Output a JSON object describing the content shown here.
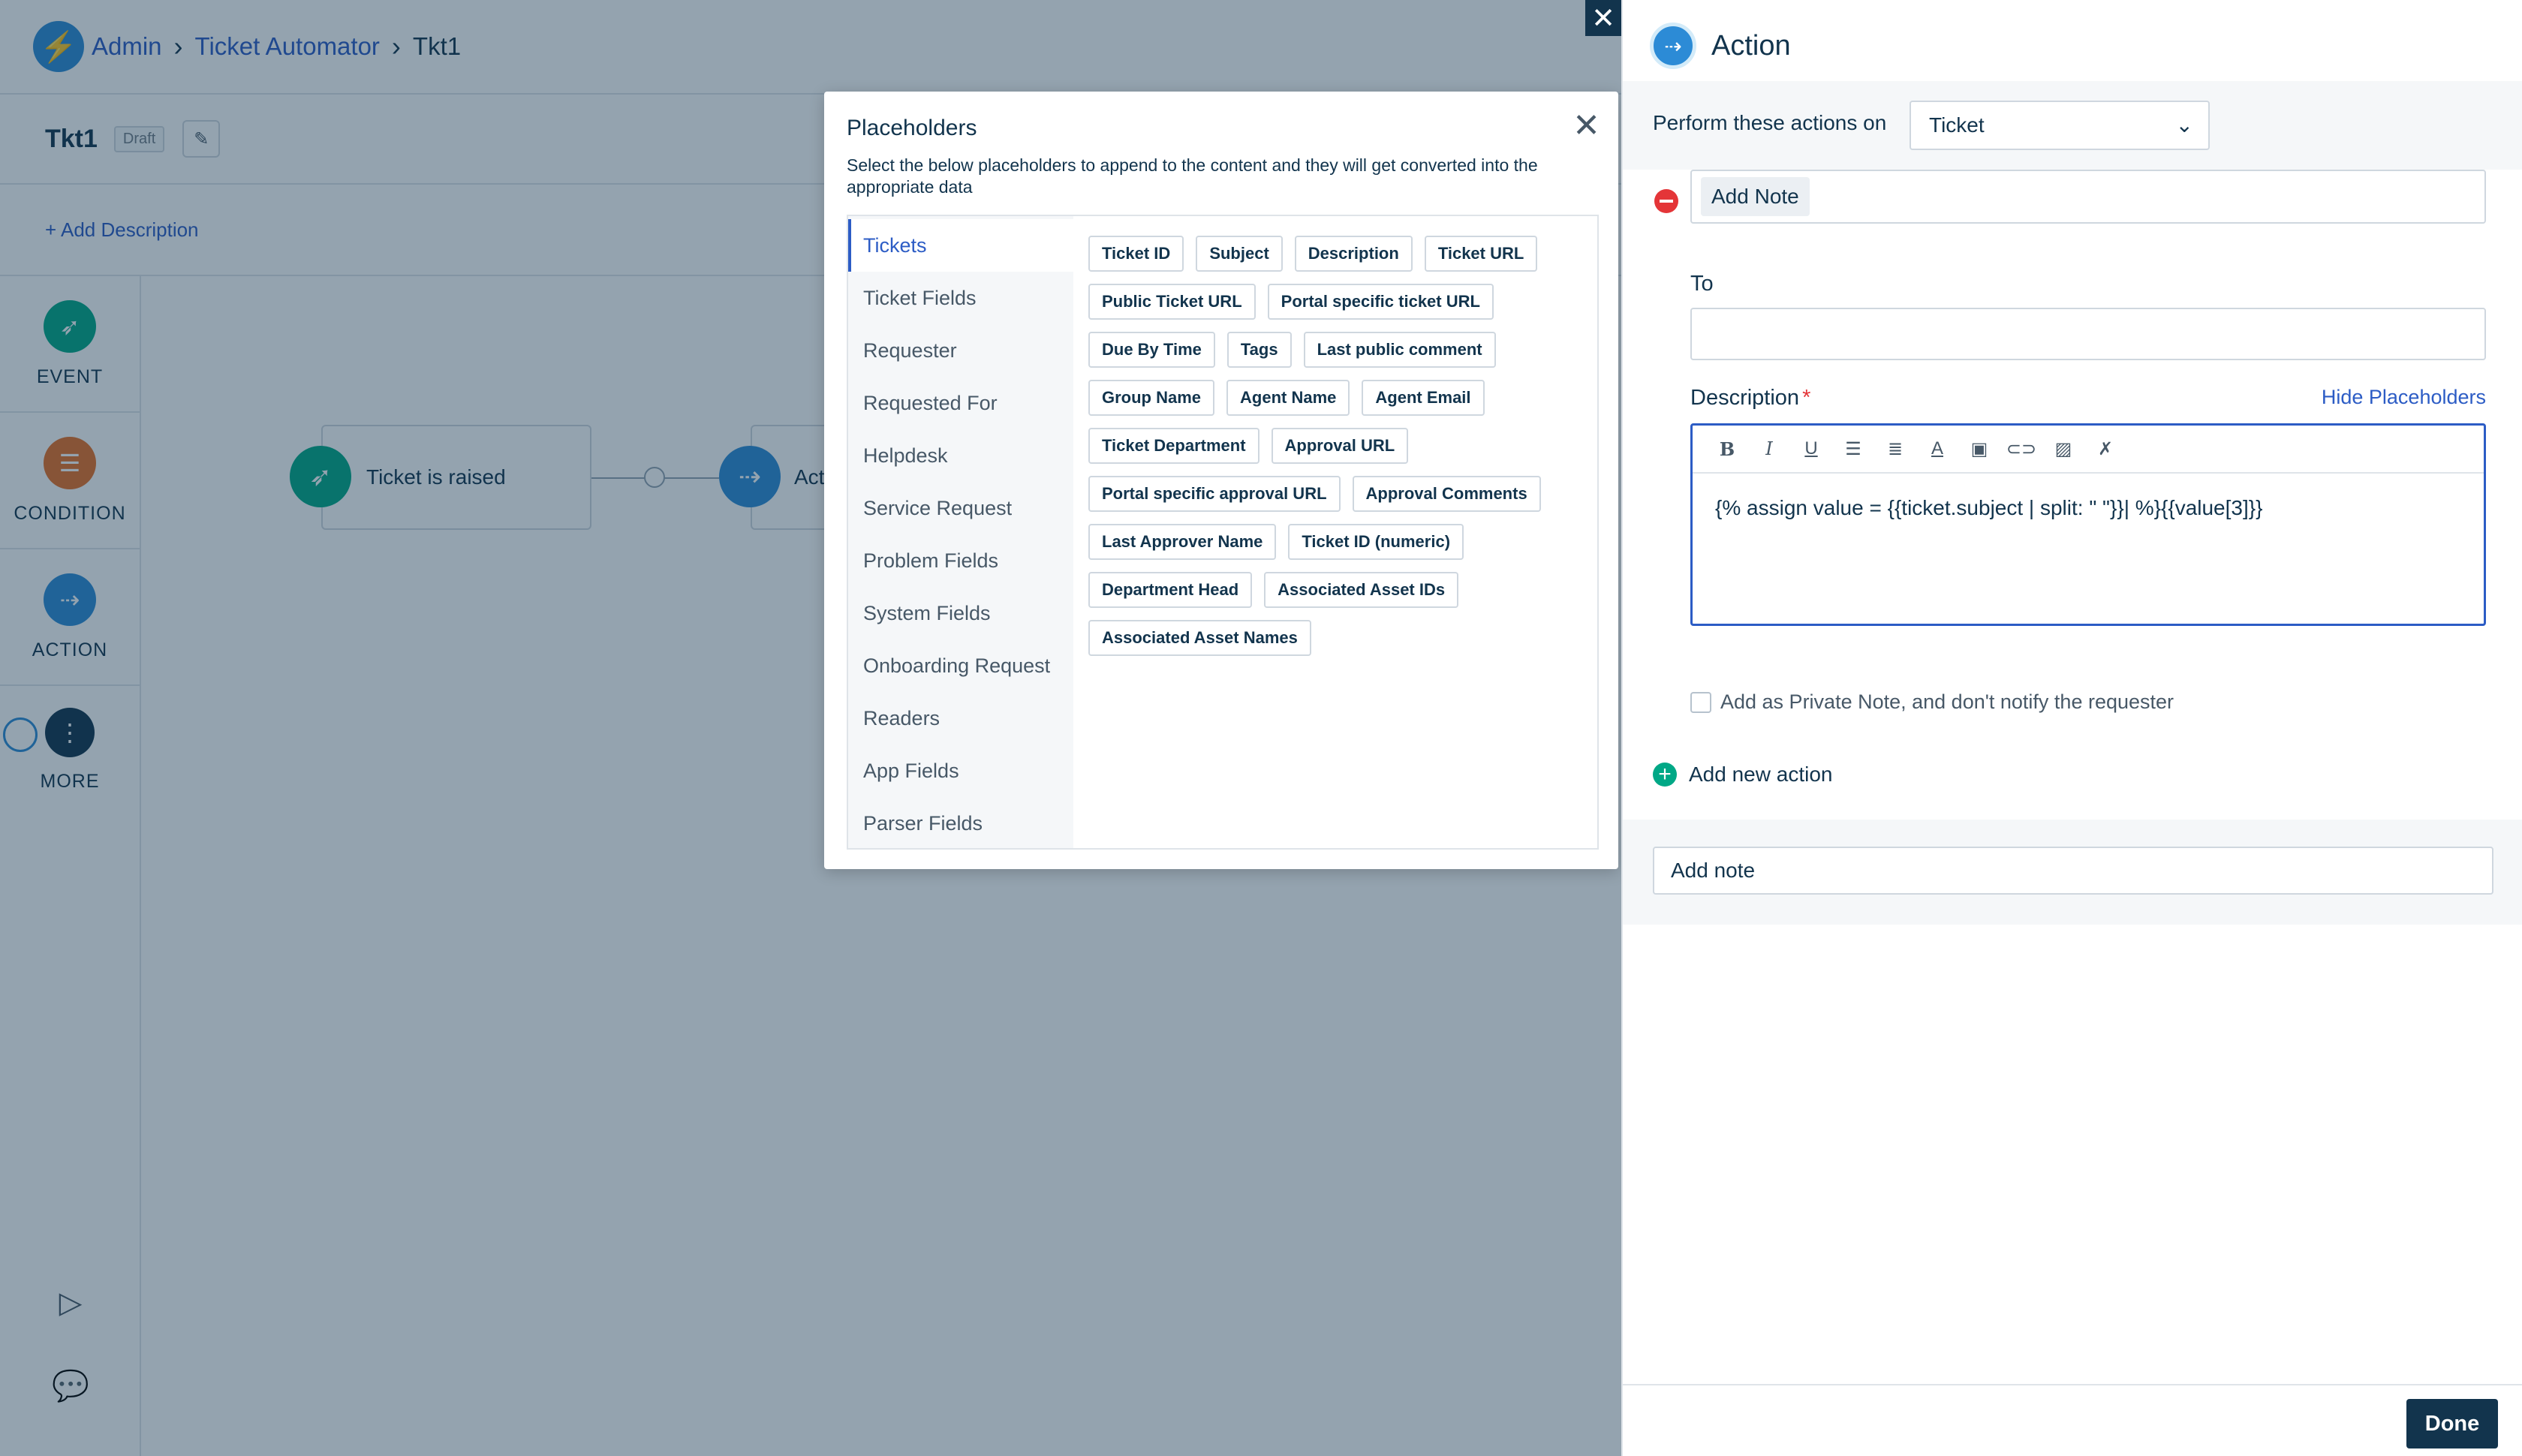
{
  "breadcrumb": {
    "items": [
      "Admin",
      "Ticket Automator"
    ],
    "current": "Tkt1"
  },
  "workflow": {
    "title": "Tkt1",
    "status": "Draft",
    "add_description": "+ Add Description"
  },
  "rail": {
    "event": "EVENT",
    "condition": "CONDITION",
    "action": "ACTION",
    "more": "MORE"
  },
  "canvas": {
    "trigger_node": "Ticket is raised",
    "action_node": "Act"
  },
  "placeholders": {
    "title": "Placeholders",
    "subtitle": "Select the below placeholders to append to the content and they will get converted into the appropriate data",
    "categories": [
      "Tickets",
      "Ticket Fields",
      "Requester",
      "Requested For",
      "Helpdesk",
      "Service Request",
      "Problem Fields",
      "System Fields",
      "Onboarding Request",
      "Readers",
      "App Fields",
      "Parser Fields"
    ],
    "active_category": "Tickets",
    "chips": [
      "Ticket ID",
      "Subject",
      "Description",
      "Ticket URL",
      "Public Ticket URL",
      "Portal specific ticket URL",
      "Due By Time",
      "Tags",
      "Last public comment",
      "Group Name",
      "Agent Name",
      "Agent Email",
      "Ticket Department",
      "Approval URL",
      "Portal specific approval URL",
      "Approval Comments",
      "Last Approver Name",
      "Ticket ID (numeric)",
      "Department Head",
      "Associated Asset IDs",
      "Associated Asset Names"
    ]
  },
  "panel": {
    "title": "Action",
    "perform_label": "Perform these actions on",
    "perform_value": "Ticket",
    "action_type": "Add Note",
    "to_label": "To",
    "description_label": "Description",
    "required_mark": "*",
    "hide_placeholders": "Hide Placeholders",
    "editor_text": "{% assign value = {{ticket.subject | split: \" \"}}| %}{{value[3]}}",
    "private_note_label": "Add as Private Note, and don't notify the requester",
    "add_new_action": "Add new action",
    "note_name": "Add note",
    "done": "Done"
  },
  "colors": {
    "accent": "#2c5cc5",
    "event": "#00a886",
    "condition": "#e86f25",
    "action": "#2c8bd6",
    "dark": "#12344d"
  }
}
